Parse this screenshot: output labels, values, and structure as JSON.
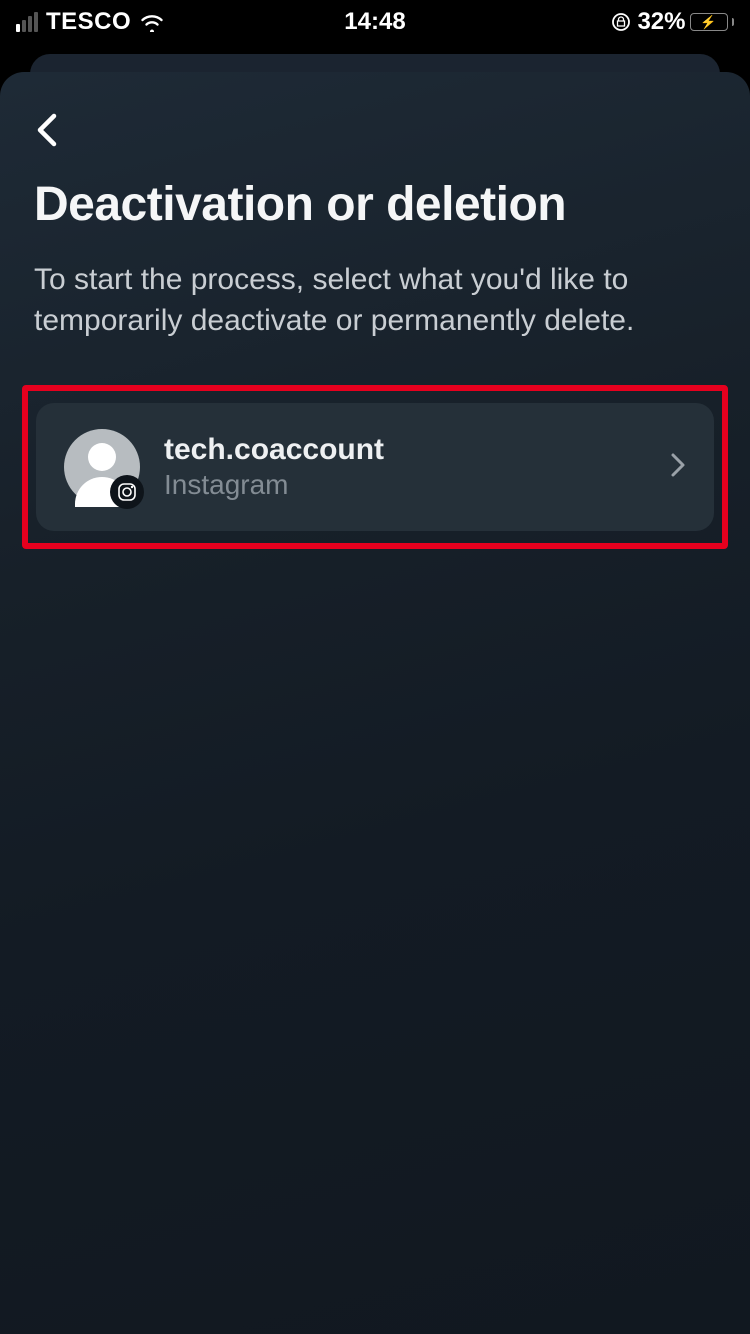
{
  "status_bar": {
    "carrier": "TESCO",
    "time": "14:48",
    "battery_pct": "32%"
  },
  "page": {
    "title": "Deactivation or deletion",
    "subtitle": "To start the process, select what you'd like to temporarily deactivate or permanently delete."
  },
  "accounts": [
    {
      "username": "tech.coaccount",
      "platform": "Instagram"
    }
  ]
}
